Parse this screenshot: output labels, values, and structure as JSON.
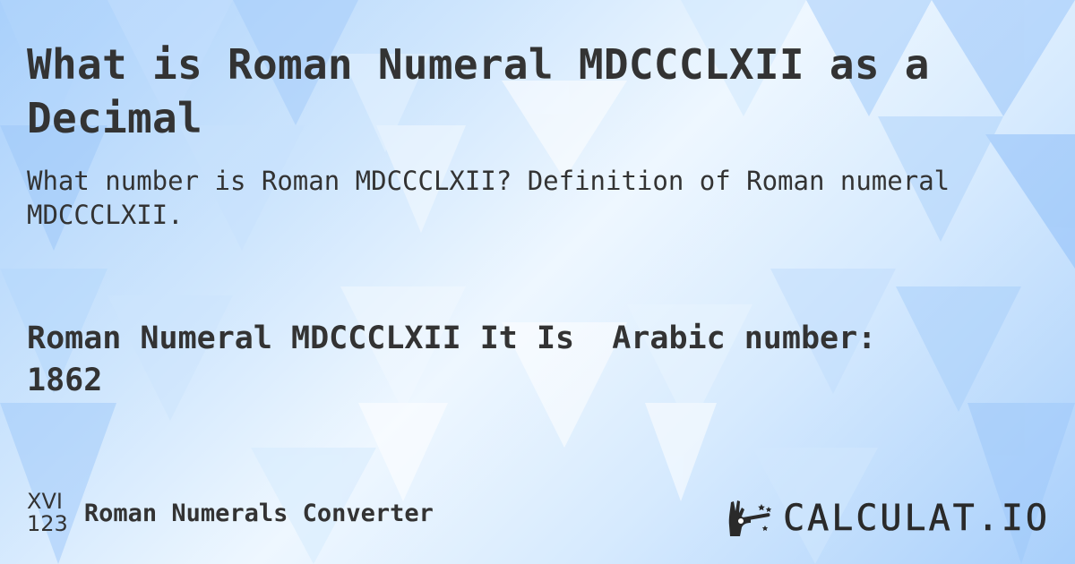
{
  "page": {
    "title": "What is Roman Numeral MDCCCLXII as a Decimal",
    "subtitle": "What number is Roman MDCCCLXII? Definition of Roman numeral MDCCCLXII.",
    "result": {
      "label": "Roman Numeral MDCCCLXII It Is  Arabic number:",
      "value": "1862"
    }
  },
  "footer": {
    "icon": {
      "name": "roman-numerals-icon",
      "top_text": "XVI",
      "bottom_text": "123"
    },
    "tool_name": "Roman Numerals Converter",
    "brand": {
      "icon": "magic-wand-hand-icon",
      "name": "CALCULAT.IO"
    }
  },
  "theme": {
    "text_color": "#333333",
    "background_light": "#eef7ff",
    "background_accent": "#a8cffb"
  }
}
